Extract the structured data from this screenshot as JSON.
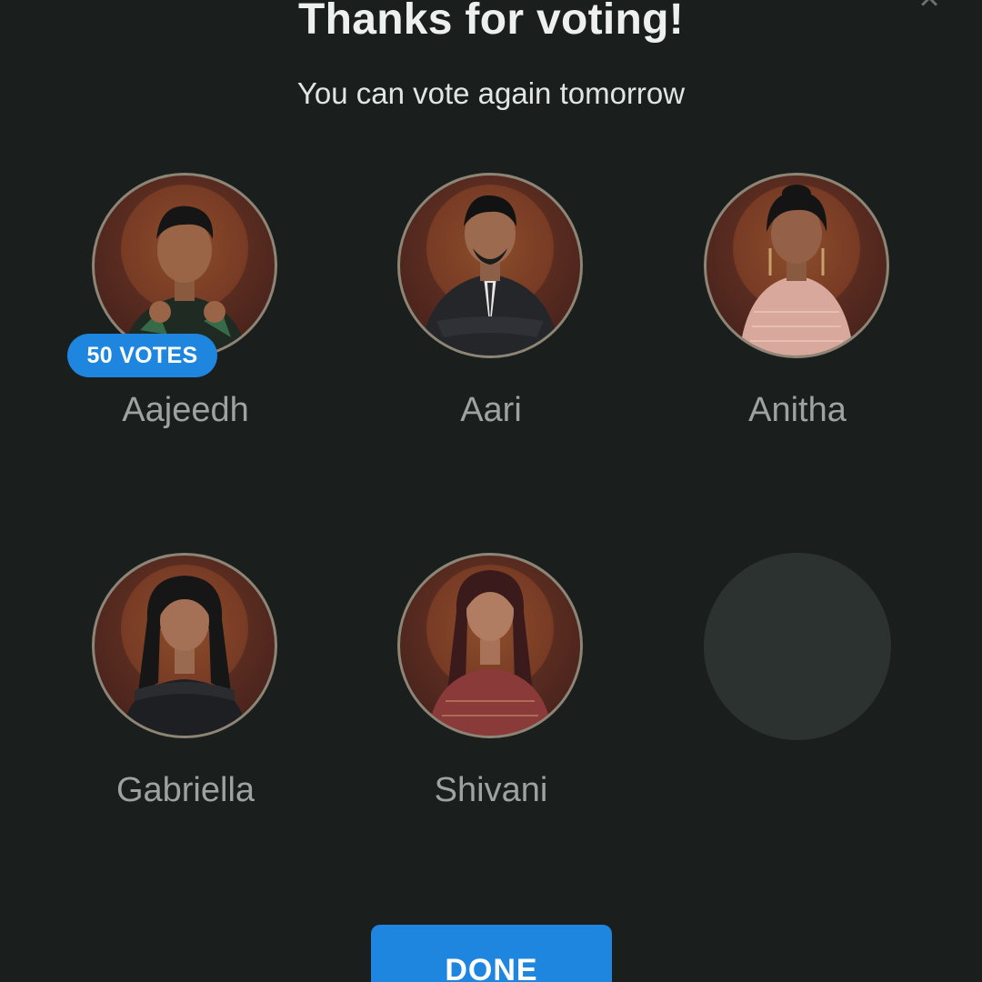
{
  "dialog": {
    "title": "Thanks for voting!",
    "subtitle": "You can vote again tomorrow",
    "close_icon": "close-icon"
  },
  "contestants": [
    {
      "name": "Aajeedh",
      "votes_label": "50 VOTES",
      "selected": true
    },
    {
      "name": "Aari",
      "votes_label": null,
      "selected": false
    },
    {
      "name": "Anitha",
      "votes_label": null,
      "selected": false
    },
    {
      "name": "Gabriella",
      "votes_label": null,
      "selected": false
    },
    {
      "name": "Shivani",
      "votes_label": null,
      "selected": false
    }
  ],
  "empty_slot": {
    "icon": "empty-avatar-placeholder"
  },
  "done_button": {
    "label": "DONE"
  },
  "colors": {
    "background": "#1a1f1d",
    "accent": "#1f86e0",
    "name_text": "#9da3a0",
    "title_text": "#eef0ef"
  }
}
